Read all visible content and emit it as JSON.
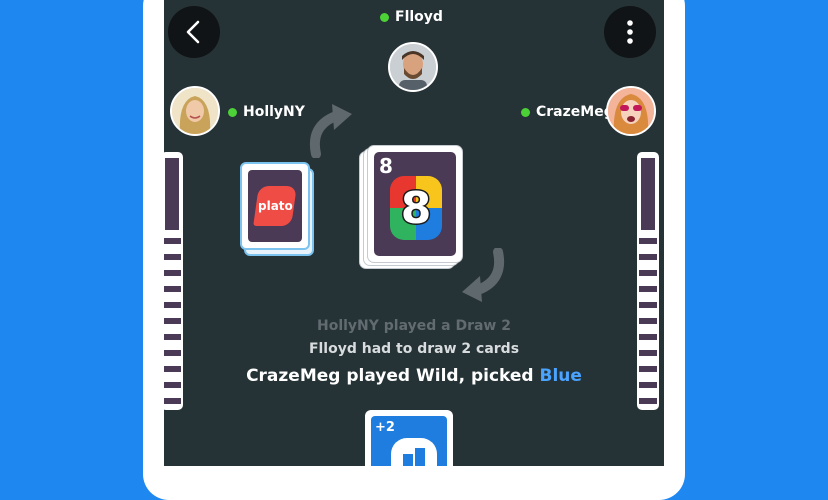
{
  "players": {
    "top": {
      "name": "Flloyd"
    },
    "left": {
      "name": "HollyNY"
    },
    "right": {
      "name": "CrazeMeg"
    }
  },
  "draw_pile": {
    "brand": "plato"
  },
  "discard": {
    "value": "8",
    "corner": "8"
  },
  "hand_card": {
    "label": "+2"
  },
  "log": {
    "line1": "HollyNY played a Draw 2",
    "line2": "Flloyd had to draw 2 cards",
    "line3_prefix": "CrazeMeg played Wild, picked ",
    "line3_color": "Blue"
  },
  "icons": {
    "back": "chevron-left-icon",
    "menu": "more-vertical-icon",
    "direction": "rotate-arrow-icon"
  },
  "colors": {
    "background": "#1e88f0",
    "table": "#253236",
    "online": "#4cd137",
    "card_red": "#e8372e",
    "card_yellow": "#f8c51c",
    "card_green": "#2fb35f",
    "card_blue": "#1f7de0"
  }
}
